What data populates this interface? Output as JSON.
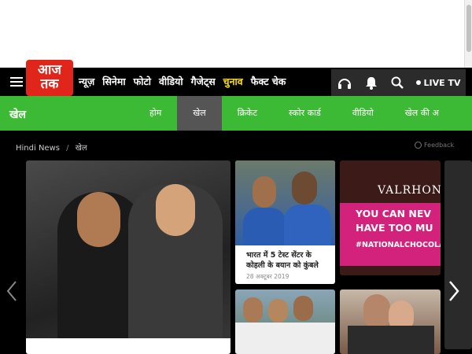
{
  "header": {
    "logo_line1": "आज",
    "logo_line2": "तक",
    "menu": [
      "न्यूज़",
      "सिनेमा",
      "फोटो",
      "वीडियो",
      "गैजेट्स",
      "चुनाव",
      "फैक्ट चेक"
    ],
    "highlight_item": "चुनाव",
    "live_label": "LIVE TV",
    "icons": [
      "menu-icon",
      "headphones-icon",
      "bell-icon",
      "search-icon"
    ]
  },
  "section": {
    "title": "खेल",
    "tabs": [
      "होम",
      "खेल",
      "क्रिकेट",
      "स्कोर कार्ड",
      "वीडियो",
      "खेल की अ"
    ],
    "active_tab": "खेल",
    "color": "#3dba35"
  },
  "breadcrumb": {
    "home": "Hindi News",
    "separator": "/",
    "current": "खेल",
    "feedback": "Feedback"
  },
  "cards": [
    {
      "title": "भारत में 5 टेस्ट सेंटर के कोहली के बयान को कुंबले",
      "date": "28 अक्टूबर 2019"
    }
  ],
  "ad": {
    "brand": "VALRHONA",
    "line1": "YOU CAN NEV",
    "line2": "HAVE TOO MU",
    "line3": "#NATIONALCHOCOLAT",
    "accent": "#d3227b"
  },
  "colors": {
    "logo_red": "#e1251b",
    "nav_bg": "#000000",
    "highlight": "#f9dd14"
  }
}
